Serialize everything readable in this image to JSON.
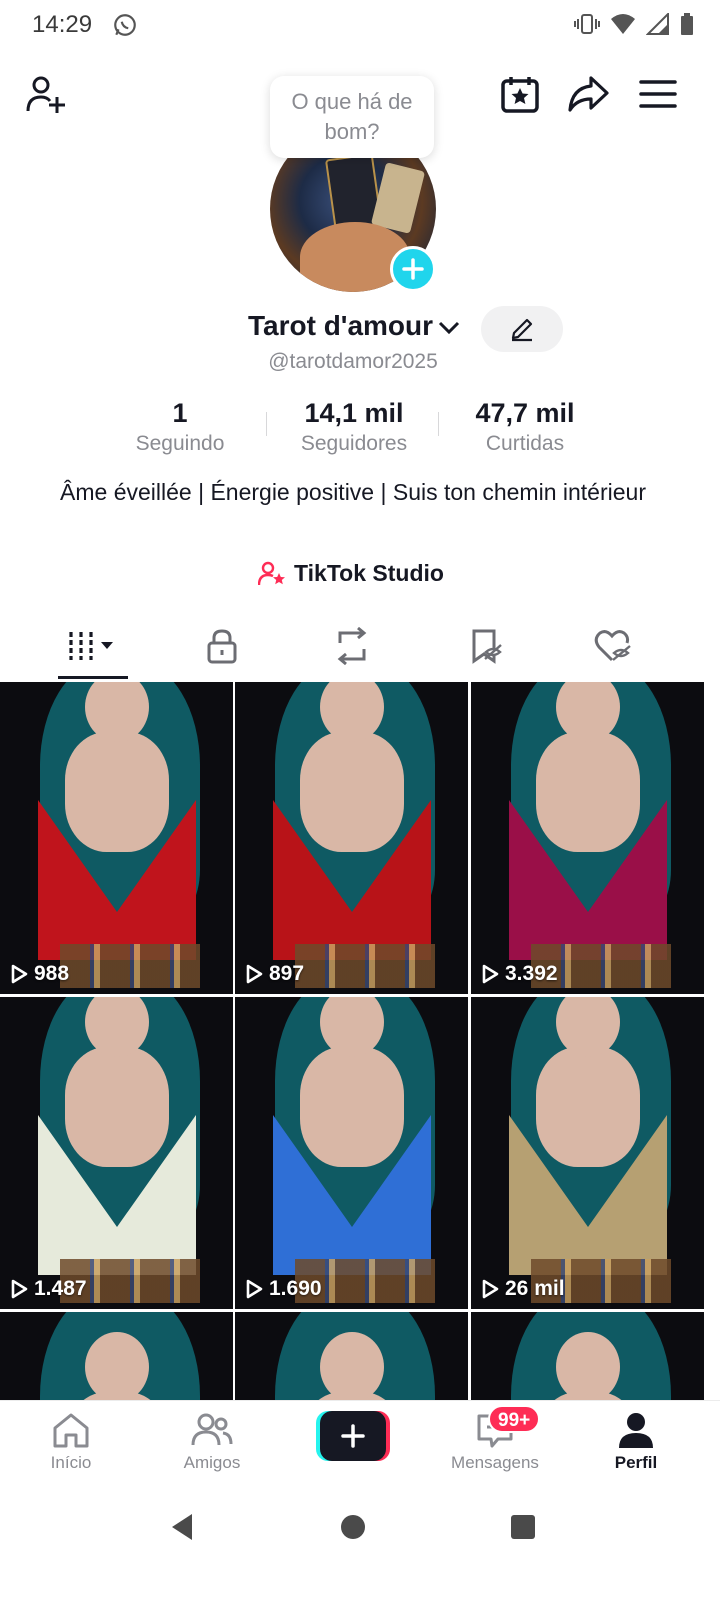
{
  "status_bar": {
    "time": "14:29"
  },
  "header": {
    "tooltip": "O que há de bom?"
  },
  "profile": {
    "name": "Tarot d'amour",
    "handle": "@tarotdamor2025",
    "stats": [
      {
        "value": "1",
        "label": "Seguindo"
      },
      {
        "value": "14,1 mil",
        "label": "Seguidores"
      },
      {
        "value": "47,7 mil",
        "label": "Curtidas"
      }
    ],
    "bio": "Âme éveillée | Énergie positive | Suis ton chemin intérieur",
    "studio_label": "TikTok Studio"
  },
  "tabs": [
    {
      "icon": "videos-grid-icon",
      "active": true
    },
    {
      "icon": "lock-icon"
    },
    {
      "icon": "repost-icon"
    },
    {
      "icon": "hidden-bookmark-icon"
    },
    {
      "icon": "hidden-liked-icon"
    }
  ],
  "videos": [
    {
      "views": "988",
      "top_color": "#c0141c"
    },
    {
      "views": "897",
      "top_color": "#b81318"
    },
    {
      "views": "3.392",
      "top_color": "#9a0f48"
    },
    {
      "views": "1.487",
      "top_color": "#e6eadb"
    },
    {
      "views": "1.690",
      "top_color": "#2f6fd6"
    },
    {
      "views": "26 mil",
      "top_color": "#b6a072"
    },
    {
      "views": "",
      "top_color": "#1a1a22"
    },
    {
      "views": "",
      "top_color": "#1a1a22"
    },
    {
      "views": "",
      "top_color": "#1a1a22"
    }
  ],
  "bottom_nav": {
    "home": "Início",
    "friends": "Amigos",
    "messages": "Mensagens",
    "messages_badge": "99+",
    "profile": "Perfil"
  },
  "colors": {
    "accent_cyan": "#20d5ec",
    "accent_red": "#fe2c55",
    "text_dark": "#161823",
    "text_muted": "#8a8b91"
  }
}
